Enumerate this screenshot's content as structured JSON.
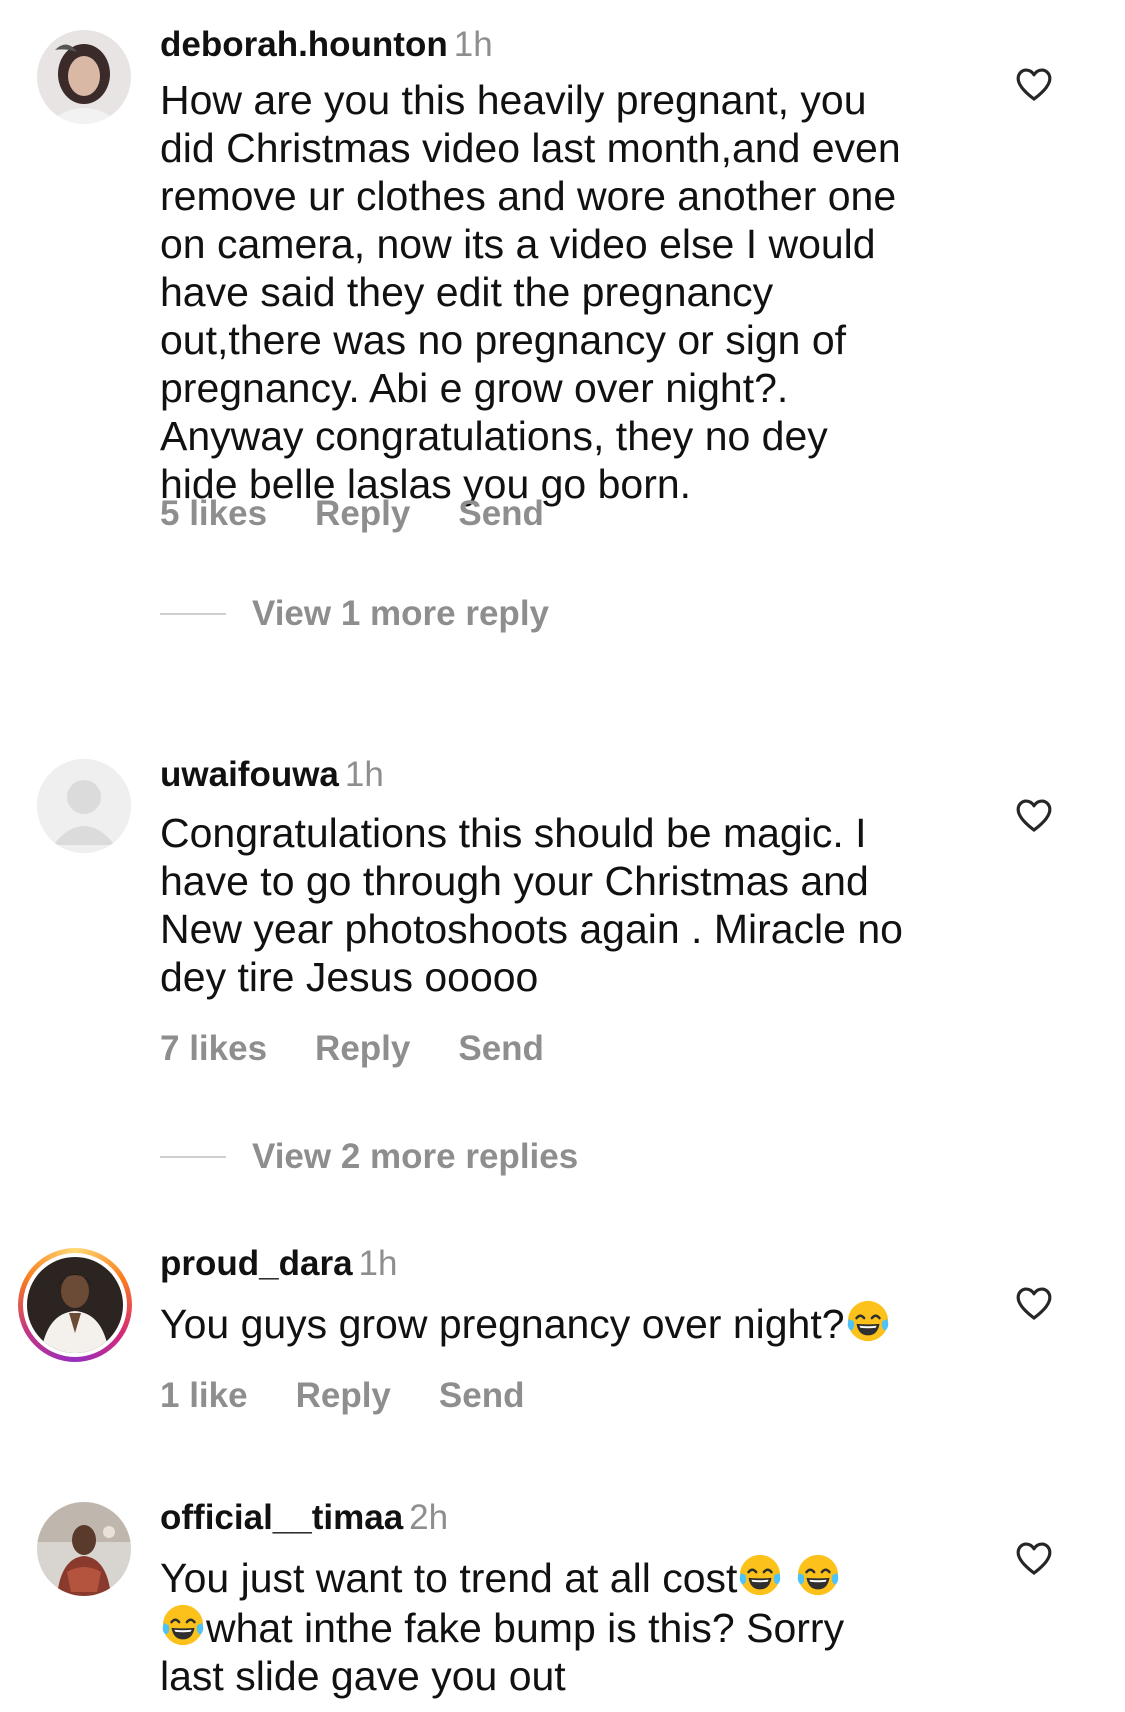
{
  "comments": [
    {
      "username": "deborah.hounton",
      "time": "1h",
      "text": "How are you this heavily pregnant,  you\ndid Christmas video last month,and even\nremove ur clothes and wore another one\non camera, now its a video else I would\nhave said they edit the pregnancy\nout,there was no pregnancy or sign of\npregnancy. Abi e grow over night?.\nAnyway congratulations, they no dey\nhide belle laslas you go born.",
      "likes": "5 likes",
      "reply": "Reply",
      "send": "Send",
      "view_replies": "View 1 more reply"
    },
    {
      "username": "uwaifouwa",
      "time": "1h",
      "text": "Congratulations this should be magic. I\nhave to go through your Christmas and\nNew year photoshoots again . Miracle no\ndey tire Jesus ooooo",
      "likes": "7 likes",
      "reply": "Reply",
      "send": "Send",
      "view_replies": "View 2 more replies"
    },
    {
      "username": "proud_dara",
      "time": "1h",
      "text": "You guys grow pregnancy over night?",
      "likes": "1 like",
      "reply": "Reply",
      "send": "Send"
    },
    {
      "username": "official__timaa",
      "time": "2h",
      "text_line1": "You just want to trend at all cost",
      "text_line2": "what inthe fake bump is this? Sorry",
      "text_line3": "last slide gave you out"
    }
  ],
  "icons": {
    "like": "heart-outline-icon",
    "emoji": "face-with-tears-of-joy-emoji"
  },
  "colors": {
    "text": "#111111",
    "secondary": "#8e8e8e",
    "story_ring": "#d62976"
  }
}
